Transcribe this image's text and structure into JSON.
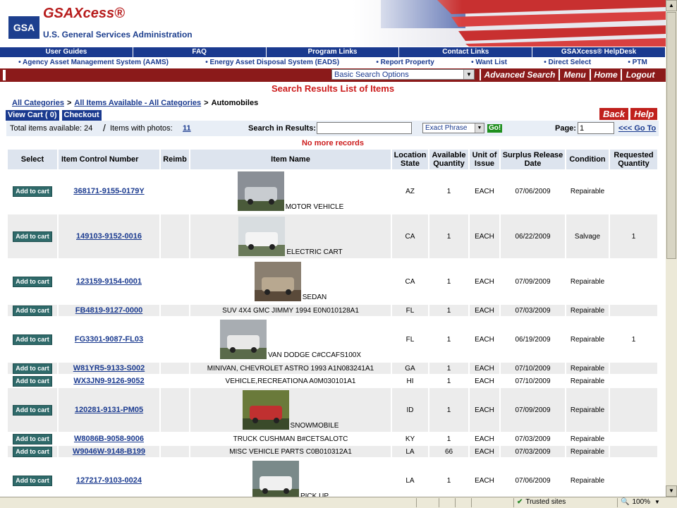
{
  "header": {
    "logo": "GSA",
    "app_title": "GSAXcess®",
    "agency": "U.S. General Services Administration"
  },
  "nav_primary": [
    "User Guides",
    "FAQ",
    "Program Links",
    "Contact Links",
    "GSAXcess® HelpDesk"
  ],
  "nav_secondary": [
    "• Agency Asset Management System (AAMS)",
    "• Energy Asset Disposal System (EADS)",
    "• Report Property",
    "• Want List",
    "• Direct Select",
    "• PTM"
  ],
  "toolbar": {
    "search_option": "Basic Search Options",
    "advanced": "Advanced Search",
    "menu": "Menu",
    "home": "Home",
    "logout": "Logout"
  },
  "page_title": "Search Results List of Items",
  "breadcrumb": {
    "all_categories": "All Categories",
    "all_items": "All Items Available - All Categories",
    "current": "Automobiles",
    "sep": ">"
  },
  "buttons": {
    "view_cart": "View Cart ( 0)",
    "checkout": "Checkout",
    "back": "Back",
    "help": "Help",
    "go": "Go!",
    "go_to": "<<< Go To"
  },
  "infobar": {
    "total_label": "Total items available: 24",
    "slash": "/",
    "photos_label": "Items with photos:",
    "photos_count": "11",
    "search_label": "Search in Results:",
    "search_value": "",
    "match_mode": "Exact Phrase",
    "page_label": "Page:",
    "page_value": "1"
  },
  "no_more": "No more records",
  "table": {
    "headers": [
      "Select",
      "Item Control Number",
      "Reimb",
      "Item Name",
      "Location State",
      "Available Quantity",
      "Unit of Issue",
      "Surplus Release Date",
      "Condition",
      "Requested Quantity"
    ],
    "add_label": "Add to cart",
    "rows": [
      {
        "icn": "368171-9155-0179Y",
        "name": "MOTOR VEHICLE",
        "photo": "car-photo",
        "state": "AZ",
        "qty": "1",
        "unit": "EACH",
        "date": "07/06/2009",
        "cond": "Repairable",
        "req": ""
      },
      {
        "icn": "149103-9152-0016",
        "name": "ELECTRIC CART",
        "photo": "cart-photo",
        "state": "CA",
        "qty": "1",
        "unit": "EACH",
        "date": "06/22/2009",
        "cond": "Salvage",
        "req": "1"
      },
      {
        "icn": "123159-9154-0001",
        "name": "SEDAN",
        "photo": "sedan-photo",
        "state": "CA",
        "qty": "1",
        "unit": "EACH",
        "date": "07/09/2009",
        "cond": "Repairable",
        "req": ""
      },
      {
        "icn": "FB4819-9127-0000",
        "name": "SUV 4X4 GMC JIMMY 1994 E0N010128A1",
        "photo": "",
        "state": "FL",
        "qty": "1",
        "unit": "EACH",
        "date": "07/03/2009",
        "cond": "Repairable",
        "req": ""
      },
      {
        "icn": "FG3301-9087-FL03",
        "name": "VAN DODGE C#CCAFS100X",
        "photo": "van-photo",
        "state": "FL",
        "qty": "1",
        "unit": "EACH",
        "date": "06/19/2009",
        "cond": "Repairable",
        "req": "1"
      },
      {
        "icn": "W81YR5-9133-S002",
        "name": "MINIVAN, CHEVROLET ASTRO 1993 A1N083241A1",
        "photo": "",
        "state": "GA",
        "qty": "1",
        "unit": "EACH",
        "date": "07/10/2009",
        "cond": "Repairable",
        "req": ""
      },
      {
        "icn": "WX3JN9-9126-9052",
        "name": "VEHICLE,RECREATIONA A0M030101A1",
        "photo": "",
        "state": "HI",
        "qty": "1",
        "unit": "EACH",
        "date": "07/10/2009",
        "cond": "Repairable",
        "req": ""
      },
      {
        "icn": "120281-9131-PM05",
        "name": "SNOWMOBILE",
        "photo": "snowmobile-photo",
        "state": "ID",
        "qty": "1",
        "unit": "EACH",
        "date": "07/09/2009",
        "cond": "Repairable",
        "req": ""
      },
      {
        "icn": "W8086B-9058-9006",
        "name": "TRUCK CUSHMAN B#CETSALOTC",
        "photo": "",
        "state": "KY",
        "qty": "1",
        "unit": "EACH",
        "date": "07/03/2009",
        "cond": "Repairable",
        "req": ""
      },
      {
        "icn": "W9046W-9148-B199",
        "name": "MISC VEHICLE PARTS C0B010312A1",
        "photo": "",
        "state": "LA",
        "qty": "66",
        "unit": "EACH",
        "date": "07/03/2009",
        "cond": "Repairable",
        "req": ""
      },
      {
        "icn": "127217-9103-0024",
        "name": "PICK UP",
        "photo": "pickup-photo",
        "state": "LA",
        "qty": "1",
        "unit": "EACH",
        "date": "07/06/2009",
        "cond": "Repairable",
        "req": ""
      }
    ]
  },
  "statusbar": {
    "zone": "Trusted sites",
    "zoom": "100%"
  },
  "colors": {
    "brand_blue": "#1a3a8f",
    "brand_red": "#8b1a1a",
    "alert_red": "#cc1a1a"
  }
}
